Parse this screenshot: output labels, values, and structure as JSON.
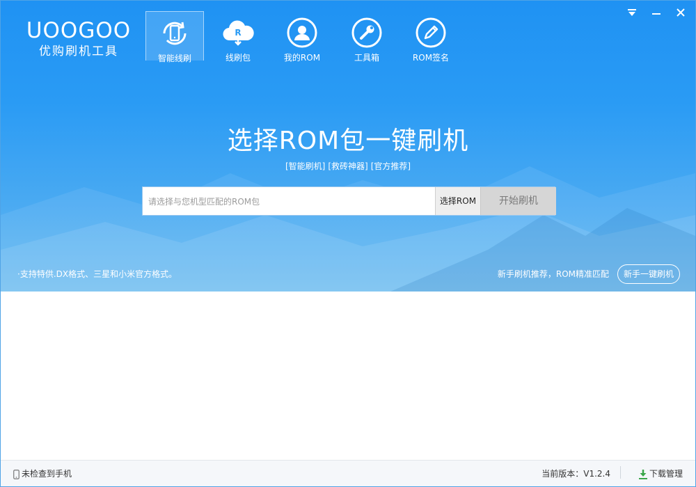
{
  "logo": {
    "en": "UOOGOO",
    "cn": "优购刷机工具"
  },
  "nav": [
    {
      "label": "智能线刷",
      "icon": "phone-refresh-icon"
    },
    {
      "label": "线刷包",
      "icon": "cloud-download-icon"
    },
    {
      "label": "我的ROM",
      "icon": "user-icon"
    },
    {
      "label": "工具箱",
      "icon": "wrench-icon"
    },
    {
      "label": "ROM签名",
      "icon": "pen-icon"
    }
  ],
  "window_controls": {
    "menu": "▾",
    "minimize": "—",
    "close": "✕"
  },
  "hero": {
    "headline": "选择ROM包一键刷机",
    "tags": [
      "[智能刷机]",
      "[救砖神器]",
      "[官方推荐]"
    ]
  },
  "search": {
    "placeholder": "请选择与您机型匹配的ROM包",
    "value": "",
    "select_label": "选择ROM",
    "start_label": "开始刷机"
  },
  "bottom_hero": {
    "support_note": "·支持特供.DX格式、三星和小米官方格式。",
    "recommend_text": "新手刷机推荐，ROM精准匹配",
    "recommend_button": "新手一键刷机"
  },
  "status": {
    "device_status": "未检查到手机",
    "version": "当前版本：V1.2.4",
    "download_label": "下载管理"
  },
  "colors": {
    "hero_top": "#1f92f3",
    "hero_bottom": "#6cbcf0",
    "download_green": "#3aa64a"
  }
}
